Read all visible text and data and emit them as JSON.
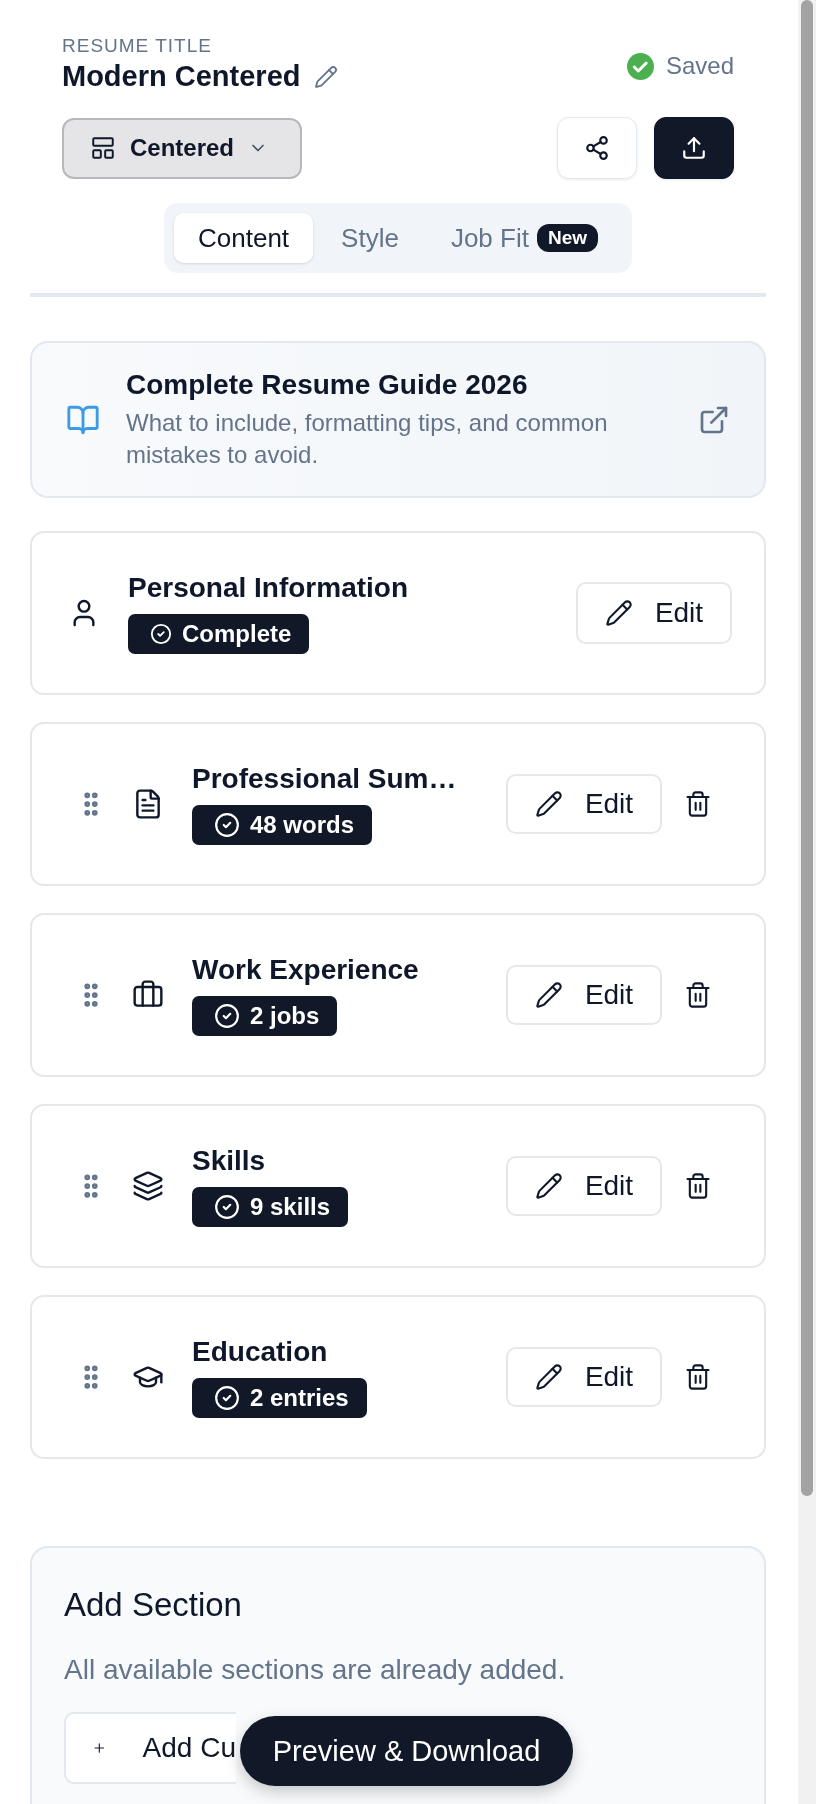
{
  "header": {
    "label": "RESUME TITLE",
    "title": "Modern Centered",
    "status": "Saved"
  },
  "layout_select": {
    "value": "Centered"
  },
  "tabs": [
    {
      "label": "Content",
      "selected": true
    },
    {
      "label": "Style",
      "selected": false
    },
    {
      "label": "Job Fit",
      "selected": false,
      "badge": "New"
    }
  ],
  "guide": {
    "title": "Complete Resume Guide 2026",
    "description": "What to include, formatting tips, and common mistakes to avoid."
  },
  "sections": [
    {
      "kind": "personal",
      "movable": false,
      "title": "Personal Information",
      "badge": "Complete",
      "action": "Edit"
    },
    {
      "kind": "summary",
      "movable": true,
      "title": "Professional Sum…",
      "badge": "48 words",
      "action": "Edit"
    },
    {
      "kind": "experience",
      "movable": true,
      "title": "Work Experience",
      "badge": "2 jobs",
      "action": "Edit"
    },
    {
      "kind": "skills",
      "movable": true,
      "title": "Skills",
      "badge": "9 skills",
      "action": "Edit"
    },
    {
      "kind": "education",
      "movable": true,
      "title": "Education",
      "badge": "2 entries",
      "action": "Edit"
    }
  ],
  "add_section": {
    "title": "Add Section",
    "note": "All available sections are already added.",
    "button": "Add Cu"
  },
  "floating_button": "Preview & Download"
}
